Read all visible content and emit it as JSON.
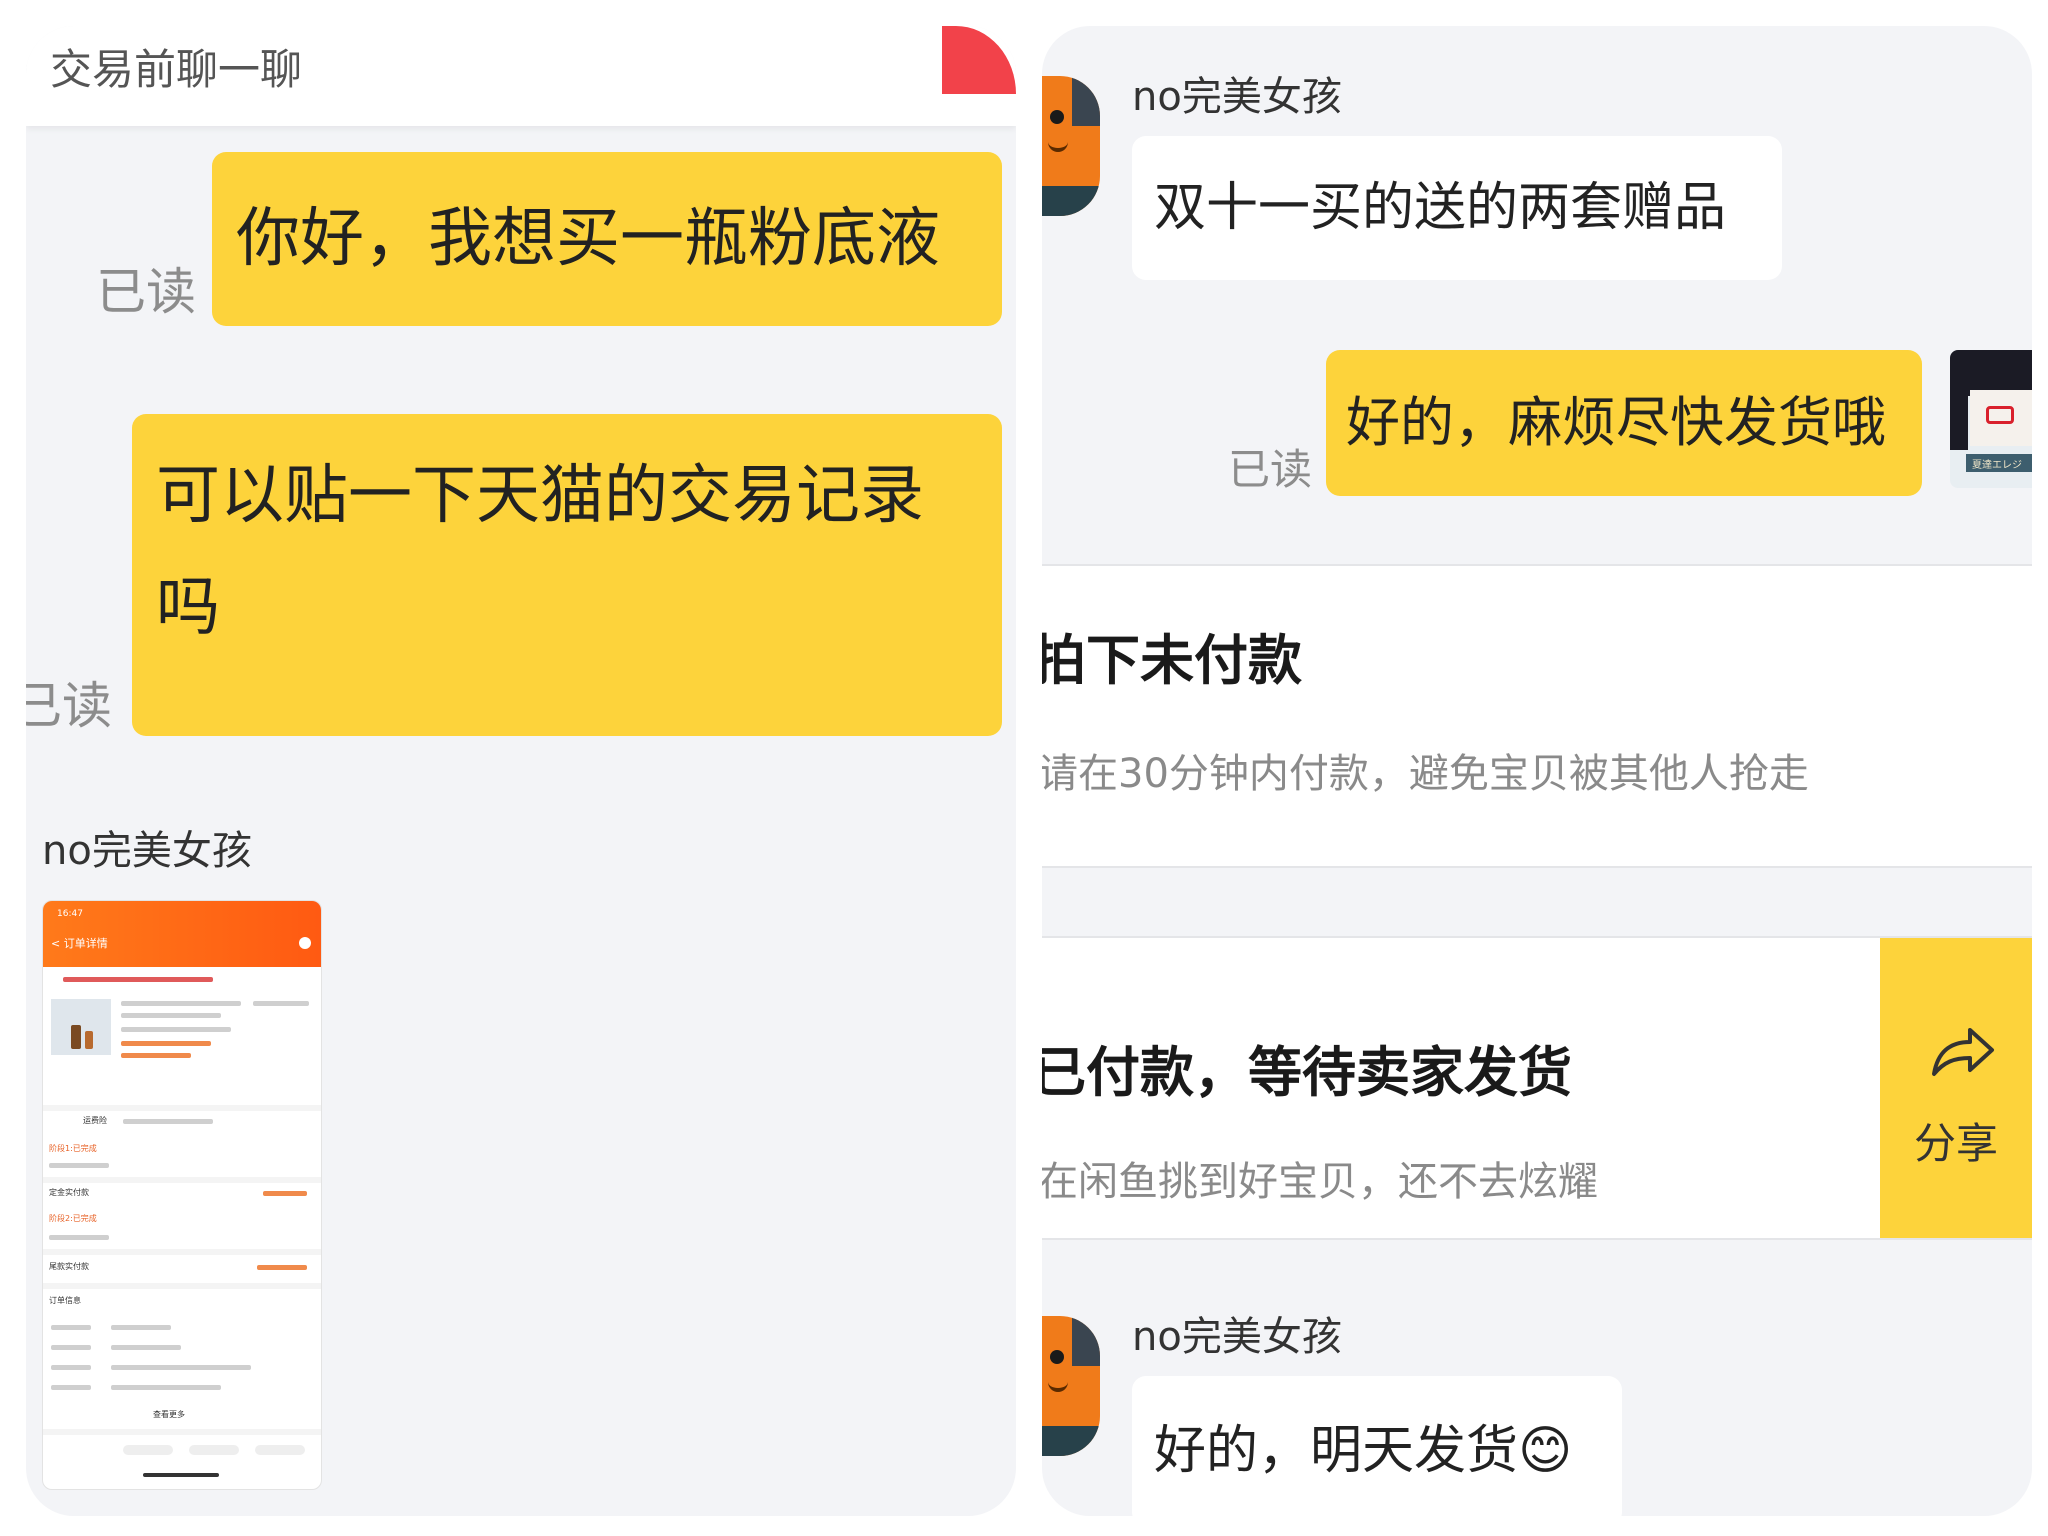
{
  "left": {
    "title": "交易前聊一聊",
    "messages": [
      {
        "text": "你好，我想买一瓶粉底液",
        "read": "已读"
      },
      {
        "line1": "可以贴一下天猫的交易记录",
        "line2": "吗",
        "read": "已读"
      }
    ],
    "sender_name": "no完美女孩",
    "thumb": {
      "status_bar": "16:47",
      "back_label": "< 订单详情",
      "labels": [
        "运费险",
        "阶段1:已完成",
        "定金实付款",
        "阶段2:已完成",
        "尾款实付款",
        "订单信息",
        "查看更多"
      ]
    }
  },
  "right": {
    "msg1": {
      "name": "no完美女孩",
      "text": "双十一买的送的两套赠品"
    },
    "msg2": {
      "text": "好的，麻烦尽快发货哦",
      "read": "已读",
      "avatar_text": "夏達エレジ"
    },
    "card1": {
      "title": "拍下未付款",
      "subtitle": "请在30分钟内付款，避免宝贝被其他人抢走"
    },
    "card2": {
      "title": "已付款，等待卖家发货",
      "subtitle": "在闲鱼挑到好宝贝，还不去炫耀",
      "share_label": "分享"
    },
    "msg3": {
      "name": "no完美女孩",
      "text": "好的，明天发货😊"
    }
  },
  "colors": {
    "bubble": "#fdd33b",
    "background": "#f3f4f7",
    "accent_red": "#f2424a"
  }
}
